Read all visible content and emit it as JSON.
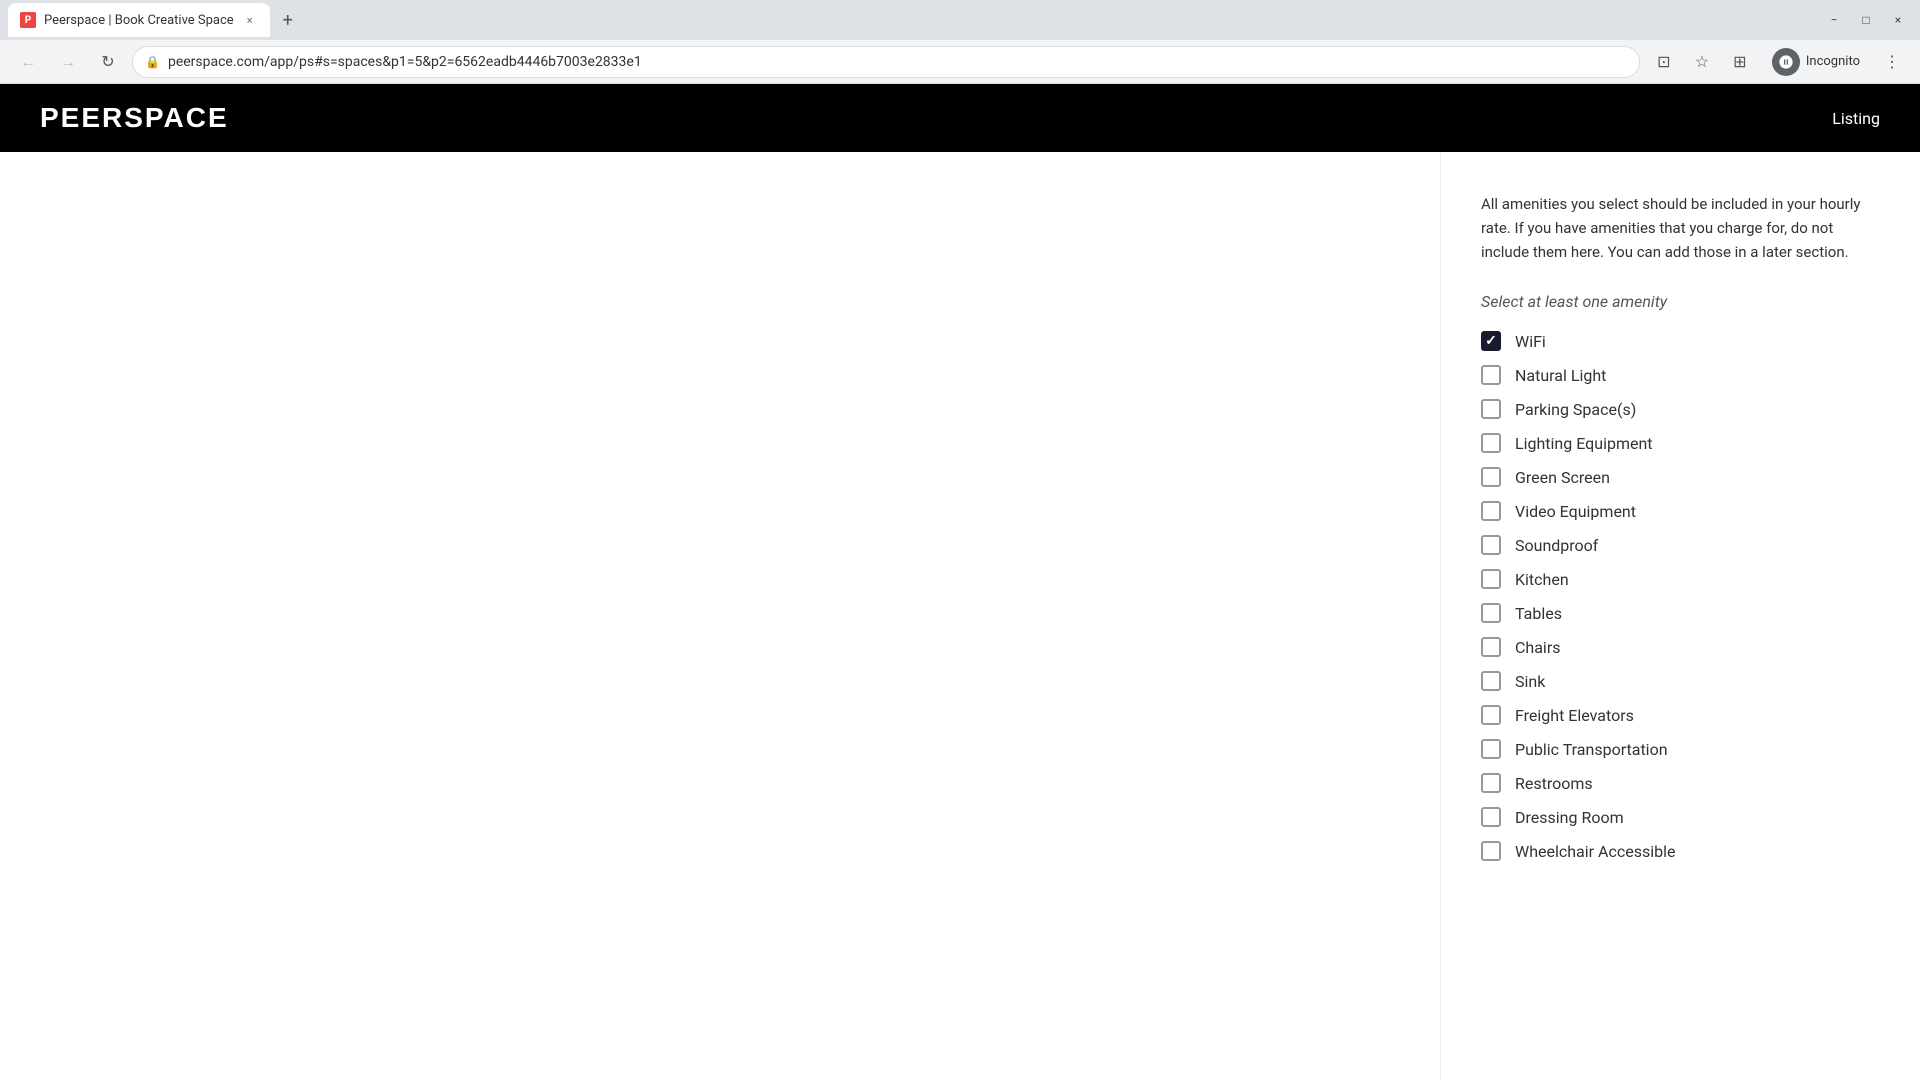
{
  "browser": {
    "tab": {
      "favicon": "P",
      "title": "Peerspace | Book Creative Space",
      "close_icon": "×"
    },
    "new_tab_icon": "+",
    "window_controls": {
      "minimize": "−",
      "maximize": "□",
      "close": "×"
    },
    "toolbar": {
      "back_icon": "←",
      "forward_icon": "→",
      "reload_icon": "↻",
      "url": "peerspace.com/app/ps#s=spaces&p1=5&p2=6562eadb4446b7003e2833e1",
      "lock_icon": "🔒",
      "cast_icon": "⊡",
      "star_icon": "☆",
      "extensions_icon": "⊞",
      "incognito_label": "Incognito",
      "menu_icon": "⋮"
    }
  },
  "site": {
    "logo": "PEERSPACE",
    "header": {
      "nav_link": "Listing"
    }
  },
  "page": {
    "description": "All amenities you select should be included in your hourly rate. If you have amenities that you charge for, do not include them here. You can add those in a later section.",
    "select_label": "Select at least one amenity",
    "amenities": [
      {
        "id": "wifi",
        "label": "WiFi",
        "checked": true
      },
      {
        "id": "natural-light",
        "label": "Natural Light",
        "checked": false
      },
      {
        "id": "parking-spaces",
        "label": "Parking Space(s)",
        "checked": false
      },
      {
        "id": "lighting-equipment",
        "label": "Lighting Equipment",
        "checked": false
      },
      {
        "id": "green-screen",
        "label": "Green Screen",
        "checked": false
      },
      {
        "id": "video-equipment",
        "label": "Video Equipment",
        "checked": false
      },
      {
        "id": "soundproof",
        "label": "Soundproof",
        "checked": false
      },
      {
        "id": "kitchen",
        "label": "Kitchen",
        "checked": false
      },
      {
        "id": "tables",
        "label": "Tables",
        "checked": false
      },
      {
        "id": "chairs",
        "label": "Chairs",
        "checked": false
      },
      {
        "id": "sink",
        "label": "Sink",
        "checked": false
      },
      {
        "id": "freight-elevators",
        "label": "Freight Elevators",
        "checked": false
      },
      {
        "id": "public-transportation",
        "label": "Public Transportation",
        "checked": false
      },
      {
        "id": "restrooms",
        "label": "Restrooms",
        "checked": false
      },
      {
        "id": "dressing-room",
        "label": "Dressing Room",
        "checked": false
      },
      {
        "id": "wheelchair-accessible",
        "label": "Wheelchair Accessible",
        "checked": false
      }
    ]
  }
}
